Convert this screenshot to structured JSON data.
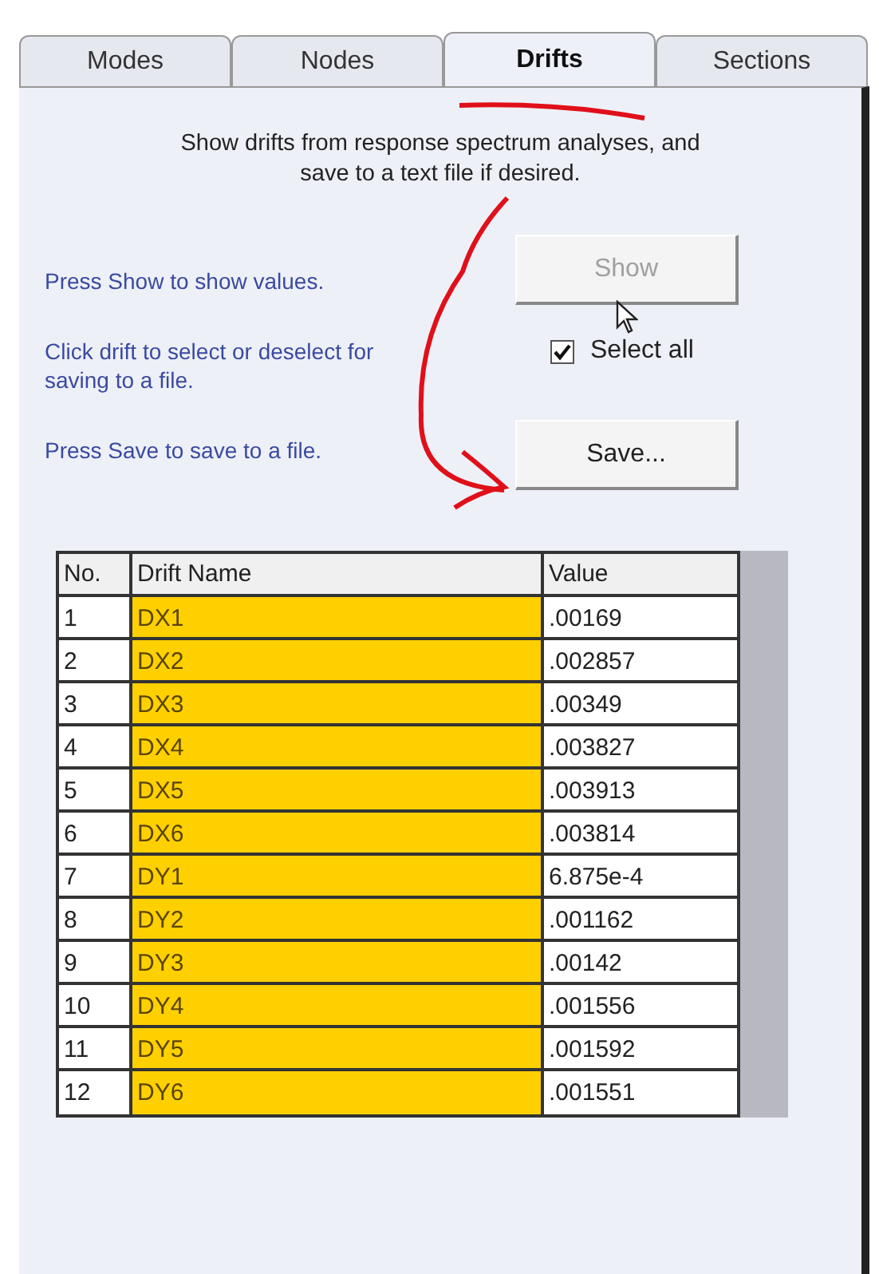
{
  "tabs": [
    {
      "label": "Modes",
      "selected": false
    },
    {
      "label": "Nodes",
      "selected": false
    },
    {
      "label": "Drifts",
      "selected": true
    },
    {
      "label": "Sections",
      "selected": false
    }
  ],
  "description": "Show drifts from response spectrum analyses, and save to a text file if desired.",
  "hints": [
    "Press Show to show values.",
    "Click drift to select or deselect for saving to a file.",
    "Press Save to save to a file."
  ],
  "show_button": {
    "label": "Show",
    "disabled": true
  },
  "select_all": {
    "label": "Select all",
    "checked": true
  },
  "save_button": {
    "label": "Save...",
    "disabled": false
  },
  "table": {
    "columns": [
      "No.",
      "Drift Name",
      "Value"
    ],
    "rows": [
      {
        "no": "1",
        "name": "DX1",
        "value": ".00169",
        "selected": true
      },
      {
        "no": "2",
        "name": "DX2",
        "value": ".002857",
        "selected": true
      },
      {
        "no": "3",
        "name": "DX3",
        "value": ".00349",
        "selected": true
      },
      {
        "no": "4",
        "name": "DX4",
        "value": ".003827",
        "selected": true
      },
      {
        "no": "5",
        "name": "DX5",
        "value": ".003913",
        "selected": true
      },
      {
        "no": "6",
        "name": "DX6",
        "value": ".003814",
        "selected": true
      },
      {
        "no": "7",
        "name": "DY1",
        "value": "6.875e-4",
        "selected": true
      },
      {
        "no": "8",
        "name": "DY2",
        "value": ".001162",
        "selected": true
      },
      {
        "no": "9",
        "name": "DY3",
        "value": ".00142",
        "selected": true
      },
      {
        "no": "10",
        "name": "DY4",
        "value": ".001556",
        "selected": true
      },
      {
        "no": "11",
        "name": "DY5",
        "value": ".001592",
        "selected": true
      },
      {
        "no": "12",
        "name": "DY6",
        "value": ".001551",
        "selected": true
      }
    ]
  }
}
